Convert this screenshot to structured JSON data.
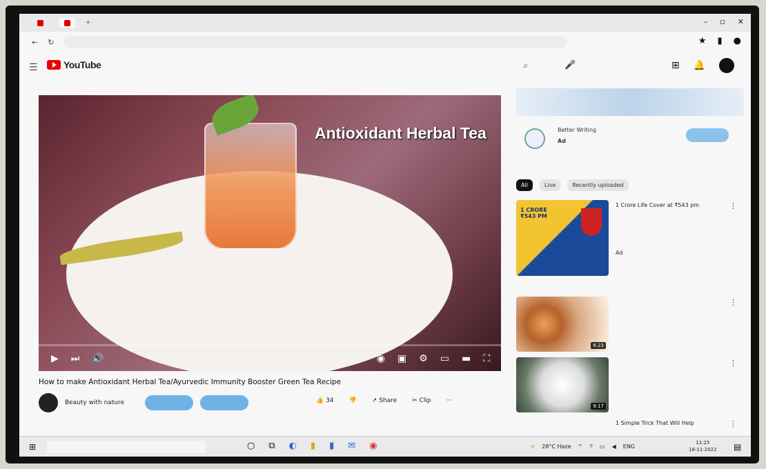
{
  "brand": {
    "name": "YouTube"
  },
  "video": {
    "overlay_title": "Antioxidant Herbal Tea",
    "title": "How to make Antioxidant Herbal Tea/Ayurvedic Immunity Booster Green Tea Recipe",
    "channel": "Beauty with nature"
  },
  "actions": {
    "likes": "34",
    "share": "Share",
    "clip": "Clip"
  },
  "ad": {
    "name": "Better Writing",
    "label": "Ad"
  },
  "chips": [
    "All",
    "Live",
    "Recently uploaded"
  ],
  "recommendations": [
    {
      "title": "1 Crore Life Cover at ₹543 pm",
      "meta": "Ad",
      "duration": ""
    },
    {
      "title": "",
      "meta": "",
      "duration": "6:23"
    },
    {
      "title": "",
      "meta": "",
      "duration": "9:17"
    },
    {
      "title": "1 Simple Trick That Will Help",
      "meta": "",
      "duration": ""
    }
  ],
  "thumb_texts": {
    "ad_thumb": "1 CRORE ₹543 PM"
  },
  "taskbar": {
    "weather": "28°C Haze",
    "lang": "ENG",
    "time": "12:25",
    "date": "18-11-2022"
  },
  "colors": {
    "youtube_red": "#e00000",
    "accent_blue": "#6fb3e6"
  }
}
